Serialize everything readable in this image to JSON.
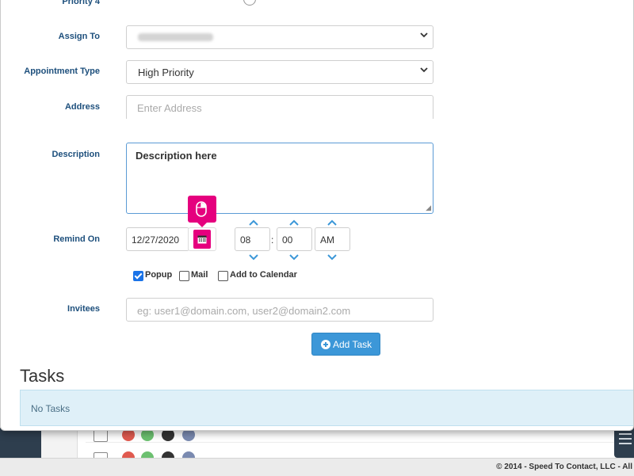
{
  "form": {
    "partial_label": "Priority 4",
    "assign_to": {
      "label": "Assign To",
      "value": ""
    },
    "appointment_type": {
      "label": "Appointment Type",
      "value": "High Priority"
    },
    "address": {
      "label": "Address",
      "placeholder": "Enter Address"
    },
    "description": {
      "label": "Description",
      "value": "Description here"
    },
    "remind_on": {
      "label": "Remind On",
      "date": "12/27/2020",
      "hour": "08",
      "separator": ":",
      "minute": "00",
      "meridian": "AM"
    },
    "options": {
      "popup": {
        "label": "Popup",
        "checked": true
      },
      "mail": {
        "label": "Mail",
        "checked": false
      },
      "calendar": {
        "label": "Add to Calendar",
        "checked": false
      }
    },
    "invitees": {
      "label": "Invitees",
      "placeholder": "eg: user1@domain.com, user2@domain2.com"
    },
    "add_button": "Add Task"
  },
  "tasks": {
    "title": "Tasks",
    "empty_message": "No Tasks"
  },
  "footer": {
    "text": "© 2014 - Speed To Contact, LLC - All"
  },
  "icons": {
    "calendar": "calendar-icon",
    "mouse": "mouse-icon",
    "plus": "plus-circle-icon",
    "chevron_up": "chevron-up-icon",
    "chevron_down": "chevron-down-icon"
  },
  "colors": {
    "accent_pink": "#e5007e",
    "primary_button": "#3c97d8",
    "label": "#1d4f7c",
    "info_box": "#dff0f8"
  }
}
